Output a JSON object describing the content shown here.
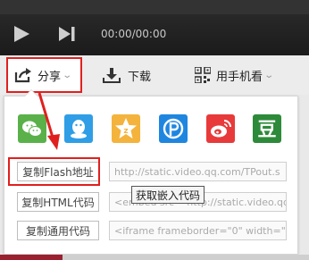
{
  "player": {
    "play_icon": "play-icon",
    "next_icon": "next-icon",
    "time": "00:00/00:00"
  },
  "toolbar": {
    "share_label": "分享",
    "download_label": "下载",
    "mobile_label": "用手机看"
  },
  "share_panel": {
    "social": [
      {
        "name": "wechat-icon"
      },
      {
        "name": "qq-icon"
      },
      {
        "name": "qzone-icon"
      },
      {
        "name": "pengyou-icon"
      },
      {
        "name": "weibo-icon"
      },
      {
        "name": "douban-icon",
        "glyph": "豆"
      }
    ],
    "rows": [
      {
        "button": "复制Flash地址",
        "value": "http://static.video.qq.com/TPout.s"
      },
      {
        "button": "复制HTML代码",
        "value": "<embed src=\"http://static.video.qq"
      },
      {
        "button": "复制通用代码",
        "value": "<iframe frameborder=\"0\" width=\"64"
      }
    ],
    "tooltip": "获取嵌入代码"
  },
  "colors": {
    "highlight": "#e0201e",
    "panel_bg": "#ffffff",
    "player_bg": "#1f1f1f"
  }
}
